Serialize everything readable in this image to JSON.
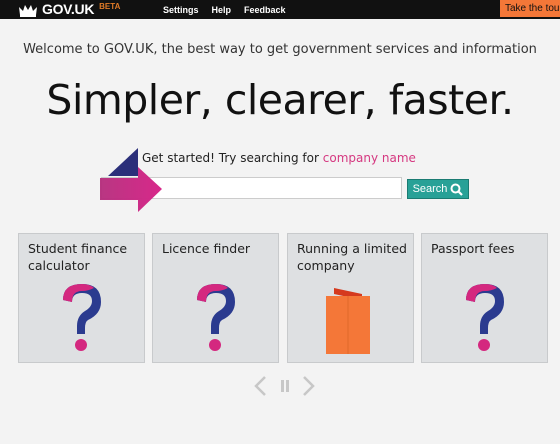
{
  "header": {
    "logo_text": "GOV.UK",
    "beta": "BETA",
    "nav": [
      "Settings",
      "Help",
      "Feedback"
    ],
    "tour_button": "Take the tour"
  },
  "welcome": {
    "tagline": "Welcome to GOV.UK, the best way to get government services and information",
    "headline": "Simpler, clearer, faster."
  },
  "search": {
    "prompt_prefix": "Get started! Try searching for ",
    "prompt_link": "company name",
    "button_label": "Search",
    "value": ""
  },
  "cards": [
    {
      "label": "Student finance calculator",
      "icon": "question-mark-icon"
    },
    {
      "label": "Licence finder",
      "icon": "question-mark-icon"
    },
    {
      "label": "Running a limited company",
      "icon": "folder-icon"
    },
    {
      "label": "Passport fees",
      "icon": "question-mark-icon"
    }
  ],
  "colors": {
    "header_bg": "#111111",
    "tour": "#f47738",
    "link_pink": "#d53880",
    "search_teal": "#28a197",
    "card_bg": "#dee0e2",
    "qmark_pink": "#d4287f",
    "qmark_navy": "#2b3b8f",
    "folder_orange": "#f47738"
  }
}
